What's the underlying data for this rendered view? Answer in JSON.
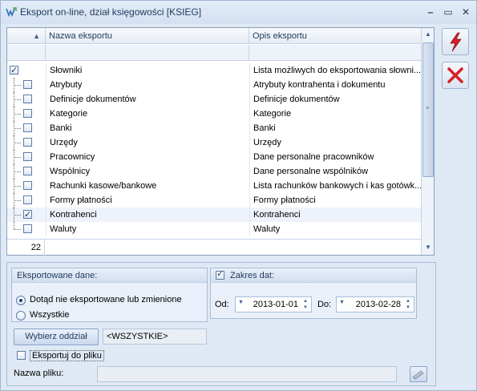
{
  "window": {
    "title": "Eksport on-line, dział księgowości [KSIEG]"
  },
  "grid": {
    "columns": {
      "sort_indicator": "▲",
      "name": "Nazwa eksportu",
      "desc": "Opis eksportu"
    },
    "rows": [
      {
        "name": "Słowniki",
        "desc": "Lista możliwych do eksportowania słowni...",
        "checked": true,
        "level": 0
      },
      {
        "name": "Atrybuty",
        "desc": "Atrybuty kontrahenta i dokumentu",
        "checked": false,
        "level": 1
      },
      {
        "name": "Definicje dokumentów",
        "desc": "Definicje dokumentów",
        "checked": false,
        "level": 1
      },
      {
        "name": "Kategorie",
        "desc": "Kategorie",
        "checked": false,
        "level": 1
      },
      {
        "name": "Banki",
        "desc": "Banki",
        "checked": false,
        "level": 1
      },
      {
        "name": "Urzędy",
        "desc": "Urzędy",
        "checked": false,
        "level": 1
      },
      {
        "name": "Pracownicy",
        "desc": "Dane personalne pracowników",
        "checked": false,
        "level": 1
      },
      {
        "name": "Wspólnicy",
        "desc": "Dane personalne wspólników",
        "checked": false,
        "level": 1
      },
      {
        "name": "Rachunki kasowe/bankowe",
        "desc": "Lista rachunków bankowych i kas gotówk...",
        "checked": false,
        "level": 1
      },
      {
        "name": "Formy płatności",
        "desc": "Formy płatności",
        "checked": false,
        "level": 1
      },
      {
        "name": "Kontrahenci",
        "desc": "Kontrahenci",
        "checked": true,
        "level": 1,
        "selected": true
      },
      {
        "name": "Waluty",
        "desc": "Waluty",
        "checked": false,
        "level": 1
      }
    ],
    "footer_count": "22"
  },
  "side": {
    "export_icon": "lightning-icon",
    "close_icon": "red-x-icon"
  },
  "exported": {
    "header": "Eksportowane dane:",
    "option1": "Dotąd nie eksportowane lub zmienione",
    "option2": "Wszystkie",
    "selected": 1
  },
  "dates": {
    "header": "Zakres dat:",
    "checked": true,
    "from_label": "Od:",
    "from_value": "2013-01-01",
    "to_label": "Do:",
    "to_value": "2013-02-28"
  },
  "branch": {
    "button": "Wybierz oddział",
    "value": "<WSZYSTKIE>"
  },
  "file": {
    "export_label": "Eksportuj do pliku",
    "export_checked": false,
    "name_label": "Nazwa pliku:",
    "name_value": ""
  },
  "colors": {
    "accent": "#1e395b",
    "export_icon": "#d91f26",
    "close_icon": "#d91f26"
  }
}
